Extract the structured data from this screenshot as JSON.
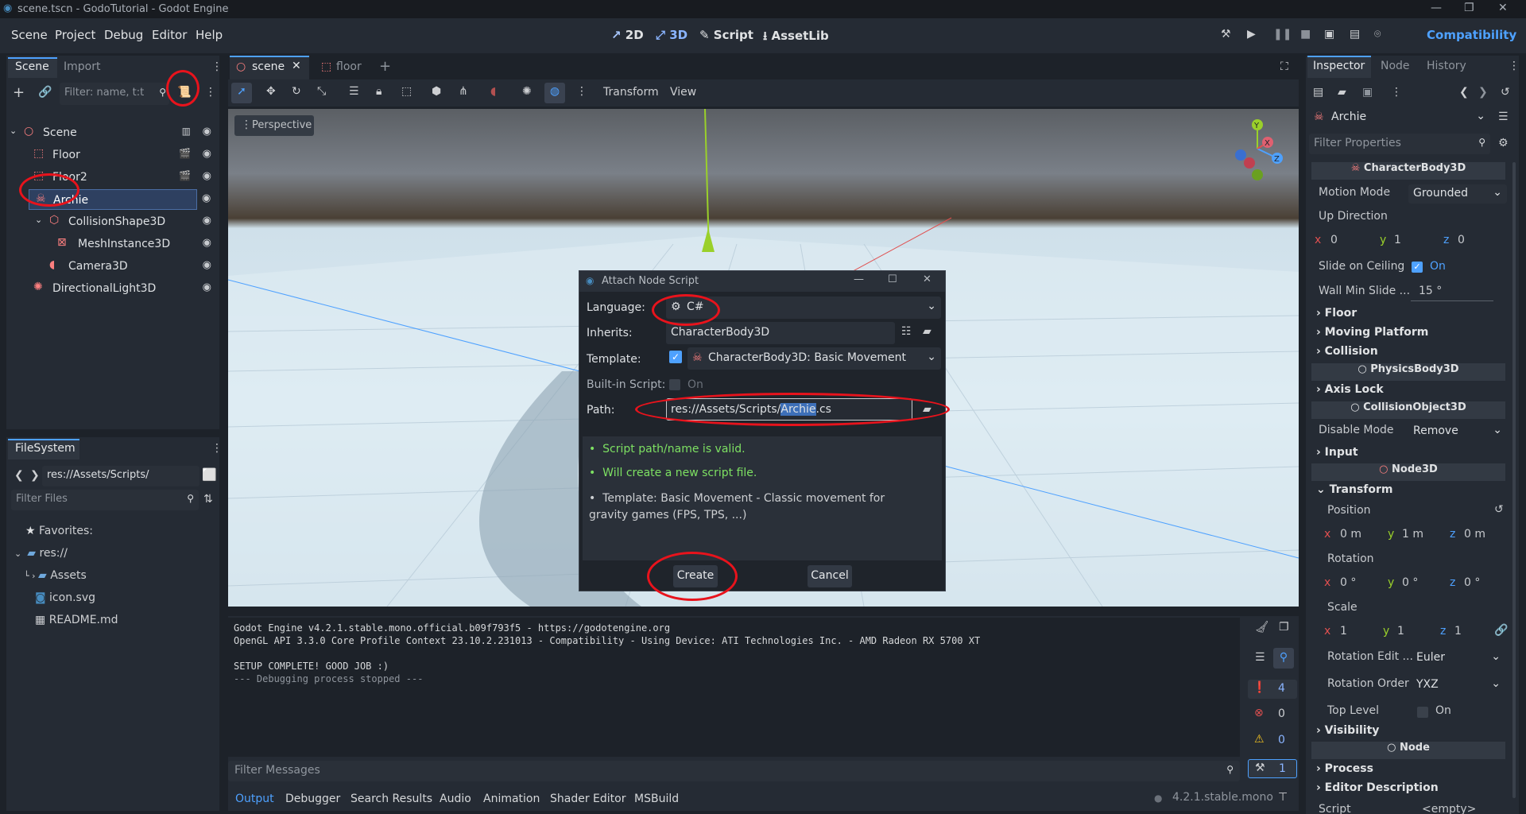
{
  "window": {
    "title": "scene.tscn - GodoTutorial - Godot Engine"
  },
  "menu": {
    "items": [
      "Scene",
      "Project",
      "Debug",
      "Editor",
      "Help"
    ],
    "modes": [
      "2D",
      "3D",
      "Script",
      "AssetLib"
    ],
    "renderer": "Compatibility"
  },
  "scene_dock": {
    "tabs": [
      "Scene",
      "Import"
    ],
    "filter_placeholder": "Filter: name, t:t",
    "tree": [
      {
        "label": "Scene",
        "icon": "node3d-icon"
      },
      {
        "label": "Floor",
        "icon": "scene-instance-icon"
      },
      {
        "label": "Floor2",
        "icon": "scene-instance-icon"
      },
      {
        "label": "Archie",
        "icon": "character-body-icon"
      },
      {
        "label": "CollisionShape3D",
        "icon": "collision-shape-icon"
      },
      {
        "label": "MeshInstance3D",
        "icon": "mesh-instance-icon"
      },
      {
        "label": "Camera3D",
        "icon": "camera-icon"
      },
      {
        "label": "DirectionalLight3D",
        "icon": "light-icon"
      }
    ]
  },
  "filesystem": {
    "tab": "FileSystem",
    "path": "res://Assets/Scripts/",
    "filter_placeholder": "Filter Files",
    "items": [
      "Favorites:",
      "res://",
      "Assets",
      "icon.svg",
      "README.md"
    ]
  },
  "editor_tabs": {
    "tabs": [
      "scene",
      "floor"
    ],
    "toolbar_menus": [
      "Transform",
      "View"
    ],
    "viewport_label": "Perspective"
  },
  "dialog": {
    "title": "Attach Node Script",
    "language_label": "Language:",
    "language": "C#",
    "inherits_label": "Inherits:",
    "inherits": "CharacterBody3D",
    "template_label": "Template:",
    "template": "CharacterBody3D: Basic Movement",
    "builtin_label": "Built-in Script:",
    "builtin_value": "On",
    "path_label": "Path:",
    "path_prefix": "res://Assets/Scripts/",
    "path_selected": "Archie",
    "path_suffix": ".cs",
    "messages": [
      "Script path/name is valid.",
      "Will create a new script file.",
      "Template: Basic Movement - Classic movement for gravity games (FPS, TPS, ...)"
    ],
    "create_label": "Create",
    "cancel_label": "Cancel"
  },
  "console": {
    "lines": [
      "Godot Engine v4.2.1.stable.mono.official.b09f793f5 - https://godotengine.org",
      "OpenGL API 3.3.0 Core Profile Context 23.10.2.231013 - Compatibility - Using Device: ATI Technologies Inc. - AMD Radeon RX 5700 XT",
      "",
      "SETUP COMPLETE! GOOD JOB :)",
      "--- Debugging process stopped ---"
    ],
    "filter_placeholder": "Filter Messages",
    "counts": {
      "messages": "4",
      "errors": "0",
      "warnings": "0",
      "other": "1"
    },
    "bottom_tabs": [
      "Output",
      "Debugger",
      "Search Results",
      "Audio",
      "Animation",
      "Shader Editor",
      "MSBuild"
    ],
    "version": "4.2.1.stable.mono"
  },
  "inspector": {
    "tabs": [
      "Inspector",
      "Node",
      "History"
    ],
    "node_name": "Archie",
    "filter_placeholder": "Filter Properties",
    "class_character": "CharacterBody3D",
    "motion_mode_label": "Motion Mode",
    "motion_mode": "Grounded",
    "up_direction_label": "Up Direction",
    "up_x": "0",
    "up_y": "1",
    "up_z": "0",
    "slide_label": "Slide on Ceiling",
    "slide_value": "On",
    "wall_label": "Wall Min Slide ...",
    "wall_value": "15 °",
    "group_floor": "Floor",
    "group_moving": "Moving Platform",
    "group_collision": "Collision",
    "class_physics": "PhysicsBody3D",
    "group_axis": "Axis Lock",
    "class_collision_object": "CollisionObject3D",
    "disable_mode_label": "Disable Mode",
    "disable_mode": "Remove",
    "group_input": "Input",
    "class_node3d": "Node3D",
    "group_transform": "Transform",
    "position_label": "Position",
    "pos_x": "0 m",
    "pos_y": "1 m",
    "pos_z": "0 m",
    "rotation_label": "Rotation",
    "rot_x": "0 °",
    "rot_y": "0 °",
    "rot_z": "0 °",
    "scale_label": "Scale",
    "scale_x": "1",
    "scale_y": "1",
    "scale_z": "1",
    "rot_edit_label": "Rotation Edit ...",
    "rot_edit": "Euler",
    "rot_order_label": "Rotation Order",
    "rot_order": "YXZ",
    "top_level_label": "Top Level",
    "top_level_value": "On",
    "group_visibility": "Visibility",
    "class_node": "Node",
    "group_process": "Process",
    "group_editor_desc": "Editor Description",
    "script_label": "Script",
    "script_value": "<empty>"
  },
  "colors": {
    "accent": "#4ea1ff",
    "valid_text": "#7de062",
    "annotation": "#e8131c"
  }
}
